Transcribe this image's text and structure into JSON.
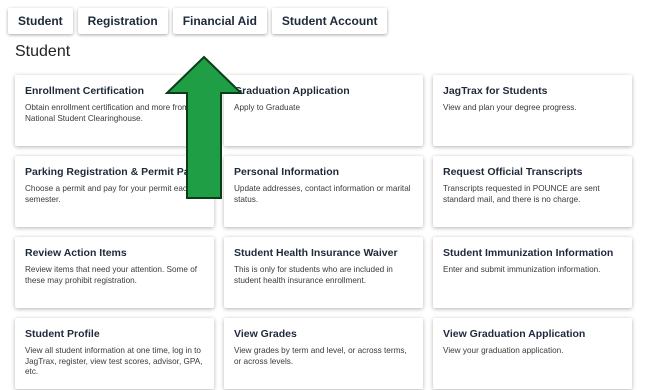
{
  "tabs": [
    {
      "label": "Student"
    },
    {
      "label": "Registration"
    },
    {
      "label": "Financial Aid"
    },
    {
      "label": "Student Account"
    }
  ],
  "page_title": "Student",
  "cards": [
    {
      "title": "Enrollment Certification",
      "desc": "Obtain enrollment certification and more from the National Student Clearinghouse."
    },
    {
      "title": "Graduation Application",
      "desc": "Apply to Graduate"
    },
    {
      "title": "JagTrax for Students",
      "desc": "View and plan your degree progress."
    },
    {
      "title": "Parking Registration & Permit Payment",
      "desc": "Choose a permit and pay for your permit each semester."
    },
    {
      "title": "Personal Information",
      "desc": "Update addresses, contact information or marital status."
    },
    {
      "title": "Request Official Transcripts",
      "desc": "Transcripts requested in POUNCE are sent standard mail, and there is no charge."
    },
    {
      "title": "Review Action Items",
      "desc": "Review items that need your attention. Some of these may prohibit registration."
    },
    {
      "title": "Student Health Insurance Waiver",
      "desc": "This is only for students who are included in student health insurance enrollment."
    },
    {
      "title": "Student Immunization Information",
      "desc": "Enter and submit immunization information."
    },
    {
      "title": "Student Profile",
      "desc": "View all student information at one time, log in to JagTrax, register, view test scores, advisor, GPA, etc."
    },
    {
      "title": "View Grades",
      "desc": "View grades by term and level, or across terms, or across levels."
    },
    {
      "title": "View Graduation Application",
      "desc": "View your graduation application."
    }
  ],
  "colors": {
    "arrow_fill": "#1f9e45",
    "arrow_stroke": "#0b3d1a"
  },
  "icons": {
    "annotation": "up-arrow-icon"
  }
}
